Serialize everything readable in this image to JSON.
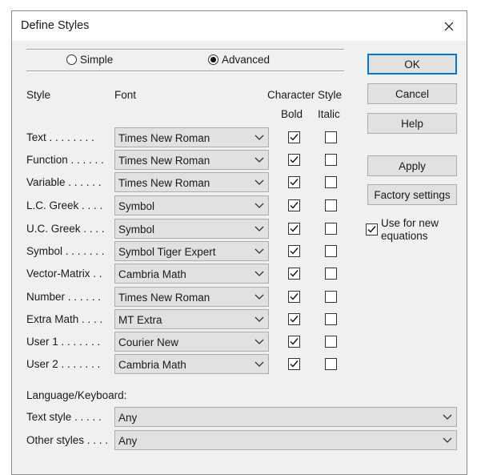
{
  "window": {
    "title": "Define Styles"
  },
  "mode": {
    "options": [
      {
        "label": "Simple",
        "selected": false
      },
      {
        "label": "Advanced",
        "selected": true
      }
    ]
  },
  "headers": {
    "style": "Style",
    "font": "Font",
    "character_style": "Character Style",
    "bold": "Bold",
    "italic": "Italic"
  },
  "rows": [
    {
      "label": "Text . . . . . . . .",
      "font": "Times New Roman",
      "bold": true,
      "italic": false
    },
    {
      "label": "Function . . . . . .",
      "font": "Times New Roman",
      "bold": true,
      "italic": false
    },
    {
      "label": "Variable . . . . . .",
      "font": "Times New Roman",
      "bold": true,
      "italic": false
    },
    {
      "label": "L.C. Greek . . . .",
      "font": "Symbol",
      "bold": true,
      "italic": false
    },
    {
      "label": "U.C. Greek . . . .",
      "font": "Symbol",
      "bold": true,
      "italic": false
    },
    {
      "label": "Symbol . . . . . . .",
      "font": "Symbol Tiger Expert",
      "bold": true,
      "italic": false
    },
    {
      "label": "Vector-Matrix . .",
      "font": "Cambria Math",
      "bold": true,
      "italic": false
    },
    {
      "label": "Number . . . . . .",
      "font": "Times New Roman",
      "bold": true,
      "italic": false
    },
    {
      "label": "Extra Math . . . .",
      "font": "MT Extra",
      "bold": true,
      "italic": false
    },
    {
      "label": "User 1 . . . . . . .",
      "font": "Courier New",
      "bold": true,
      "italic": false
    },
    {
      "label": "User 2 . . . . . . .",
      "font": "Cambria Math",
      "bold": true,
      "italic": false
    }
  ],
  "language": {
    "heading": "Language/Keyboard:",
    "text_style_label": "Text style . . . . .",
    "text_style_value": "Any",
    "other_styles_label": "Other styles . . . .",
    "other_styles_value": "Any"
  },
  "buttons": {
    "ok": "OK",
    "cancel": "Cancel",
    "help": "Help",
    "apply": "Apply",
    "factory": "Factory settings"
  },
  "use_for_new": {
    "label": "Use for new equations",
    "checked": true
  },
  "icons": {
    "close": "close-icon",
    "dropdown": "chevron-down-icon",
    "check": "checkmark-icon"
  }
}
